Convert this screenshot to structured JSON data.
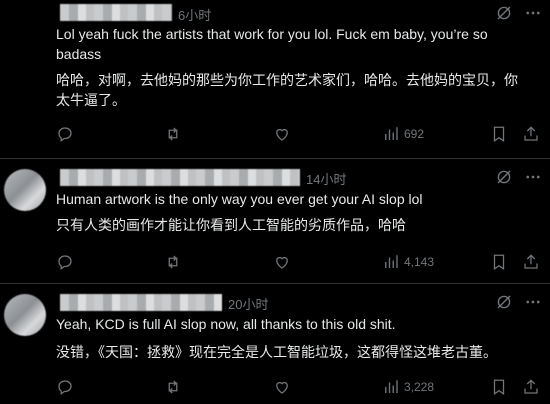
{
  "replies": [
    {
      "time": "6小时",
      "text": "Lol yeah fuck the artists that work for you lol. Fuck em baby, you’re so badass",
      "translation": "哈哈，对啊，去他妈的那些为你工作的艺术家们，哈哈。去他妈的宝贝，你太牛逼了。",
      "views": "692"
    },
    {
      "time": "14小时",
      "text": "Human artwork is the only way you ever get your AI slop lol",
      "translation": "只有人类的画作才能让你看到人工智能的劣质作品，哈哈",
      "views": "4,143"
    },
    {
      "time": "20小时",
      "text": "Yeah, KCD is full AI slop now, all thanks to this old shit.",
      "translation": "没错，《天国：拯救》现在完全是人工智能垃圾，这都得怪这堆老古董。",
      "views": "3,228"
    }
  ]
}
